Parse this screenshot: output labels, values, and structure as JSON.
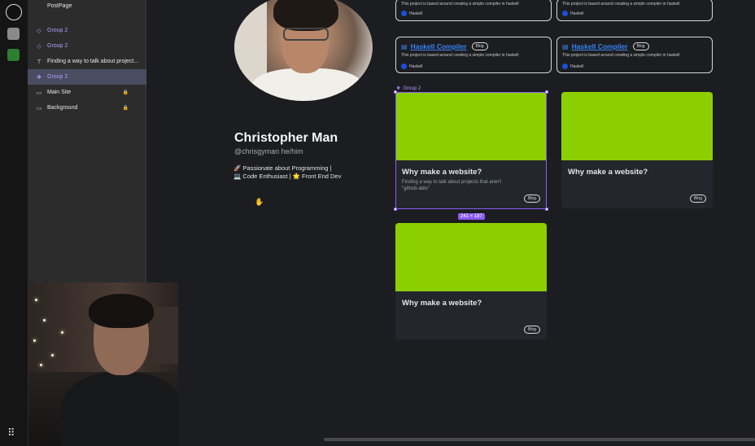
{
  "layers_panel": {
    "items": [
      {
        "label": "PostPage",
        "icon": "frame-icon",
        "style": "normal"
      },
      {
        "label": "Group 2",
        "icon": "component-icon",
        "style": "purple"
      },
      {
        "label": "Group 2",
        "icon": "component-icon",
        "style": "purple"
      },
      {
        "label": "Finding a way to talk about project...",
        "icon": "text-icon",
        "style": "normal"
      },
      {
        "label": "Group 2",
        "icon": "component-icon",
        "style": "purple-selected"
      },
      {
        "label": "Main Site",
        "icon": "frame-icon",
        "style": "locked"
      },
      {
        "label": "Background",
        "icon": "frame-icon",
        "style": "locked"
      }
    ]
  },
  "profile": {
    "name": "Christopher Man",
    "handle": "@chrisgyman he/him",
    "bio_line1": "🚀 Passionate about Programming |",
    "bio_line2": "💻 Code Enthusiast | 🌟 Front End Dev"
  },
  "project_cards": {
    "top_desc": "This project is based around creating a simple compiler in haskell",
    "lang": "Haskell",
    "title": "Haskell Compiler",
    "tag": "Blog",
    "lang_color": "#1d4ed8"
  },
  "group_label": "Group 2",
  "blog_cards": [
    {
      "title": "Why make a website?",
      "desc": "Finding a way to talk about projects that aren't \"github-able\"",
      "tag": "Blog"
    },
    {
      "title": "Why make a website?",
      "desc": "",
      "tag": "Blog"
    },
    {
      "title": "Why make a website?",
      "desc": "",
      "tag": "Blog"
    }
  ],
  "selection_dims": "241 × 187",
  "colors": {
    "accent_purple": "#8b5cf6",
    "card_green": "#8ccf00",
    "link_blue": "#3b82f6"
  }
}
